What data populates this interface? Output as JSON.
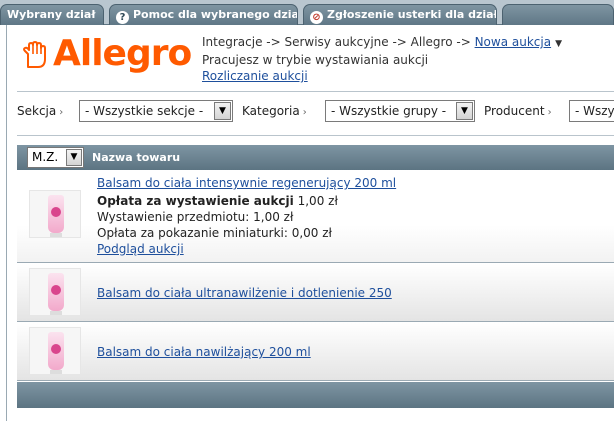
{
  "tabs": [
    {
      "label": "Wybrany dział",
      "icon": ""
    },
    {
      "label": "Pomoc dla wybranego działu",
      "icon": "help-icon"
    },
    {
      "label": "Zgłoszenie usterki dla działu",
      "icon": "bug-icon"
    }
  ],
  "logo": {
    "text": "Allegro",
    "icon": "hand-icon",
    "color": "#ff5a00"
  },
  "breadcrumb": {
    "path": "Integracje -> Serwisy aukcyjne -> Allegro ->",
    "current": "Nowa aukcja",
    "mode": "Pracujesz w trybie wystawiania aukcji",
    "billing_link": "Rozliczanie aukcji"
  },
  "filters": {
    "section_label": "Sekcja",
    "section_value": "- Wszystkie sekcje -",
    "category_label": "Kategoria",
    "category_value": "- Wszystkie grupy -",
    "producer_label": "Producent",
    "producer_value": "- Wszys"
  },
  "table": {
    "mz_value": "M.Z.",
    "column_name": "Nazwa towaru",
    "rows": [
      {
        "name": "Balsam do ciała intensywnie regenerujący 200 ml",
        "fee_label": "Opłata za wystawienie aukcji",
        "fee_value": "1,00 zł",
        "listing_line": "Wystawienie przedmiotu: 1,00 zł",
        "thumbnail_line": "Opłata za pokazanie miniaturki: 0,00 zł",
        "preview_link": "Podgląd aukcji"
      },
      {
        "name": "Balsam do ciała ultranawilżenie i dotlenienie 250"
      },
      {
        "name": "Balsam do ciała nawilżający 200 ml"
      }
    ]
  },
  "colors": {
    "accent": "#ff5a00",
    "header_bar": "#6a8190",
    "link": "#1e4f9c"
  }
}
